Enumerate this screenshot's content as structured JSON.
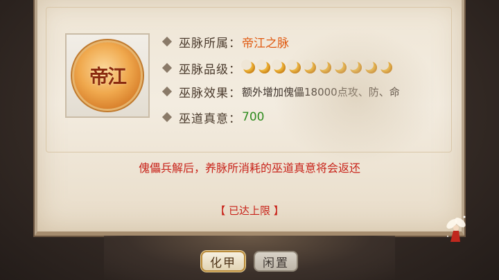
{
  "emblem": {
    "text": "帝江"
  },
  "info": {
    "belong": {
      "label": "巫脉所属",
      "value": "帝江之脉"
    },
    "grade": {
      "label": "巫脉品级",
      "moon_count": 10,
      "moon_color": "#f0b73a"
    },
    "effect": {
      "label": "巫脉效果",
      "value": "额外增加傀儡18000点攻、防、命"
    },
    "essence": {
      "label": "巫道真意",
      "value": "700"
    }
  },
  "notice": "傀儡兵解后，养脉所消耗的巫道真意将会返还",
  "limit_status": "【 已达上限 】",
  "tabs": [
    {
      "label": "化甲",
      "active": true
    },
    {
      "label": "闲置",
      "active": false
    }
  ],
  "colors": {
    "accent_orange": "#e05a10",
    "value_green": "#2e8b1e",
    "notice_red": "#c8231a"
  }
}
